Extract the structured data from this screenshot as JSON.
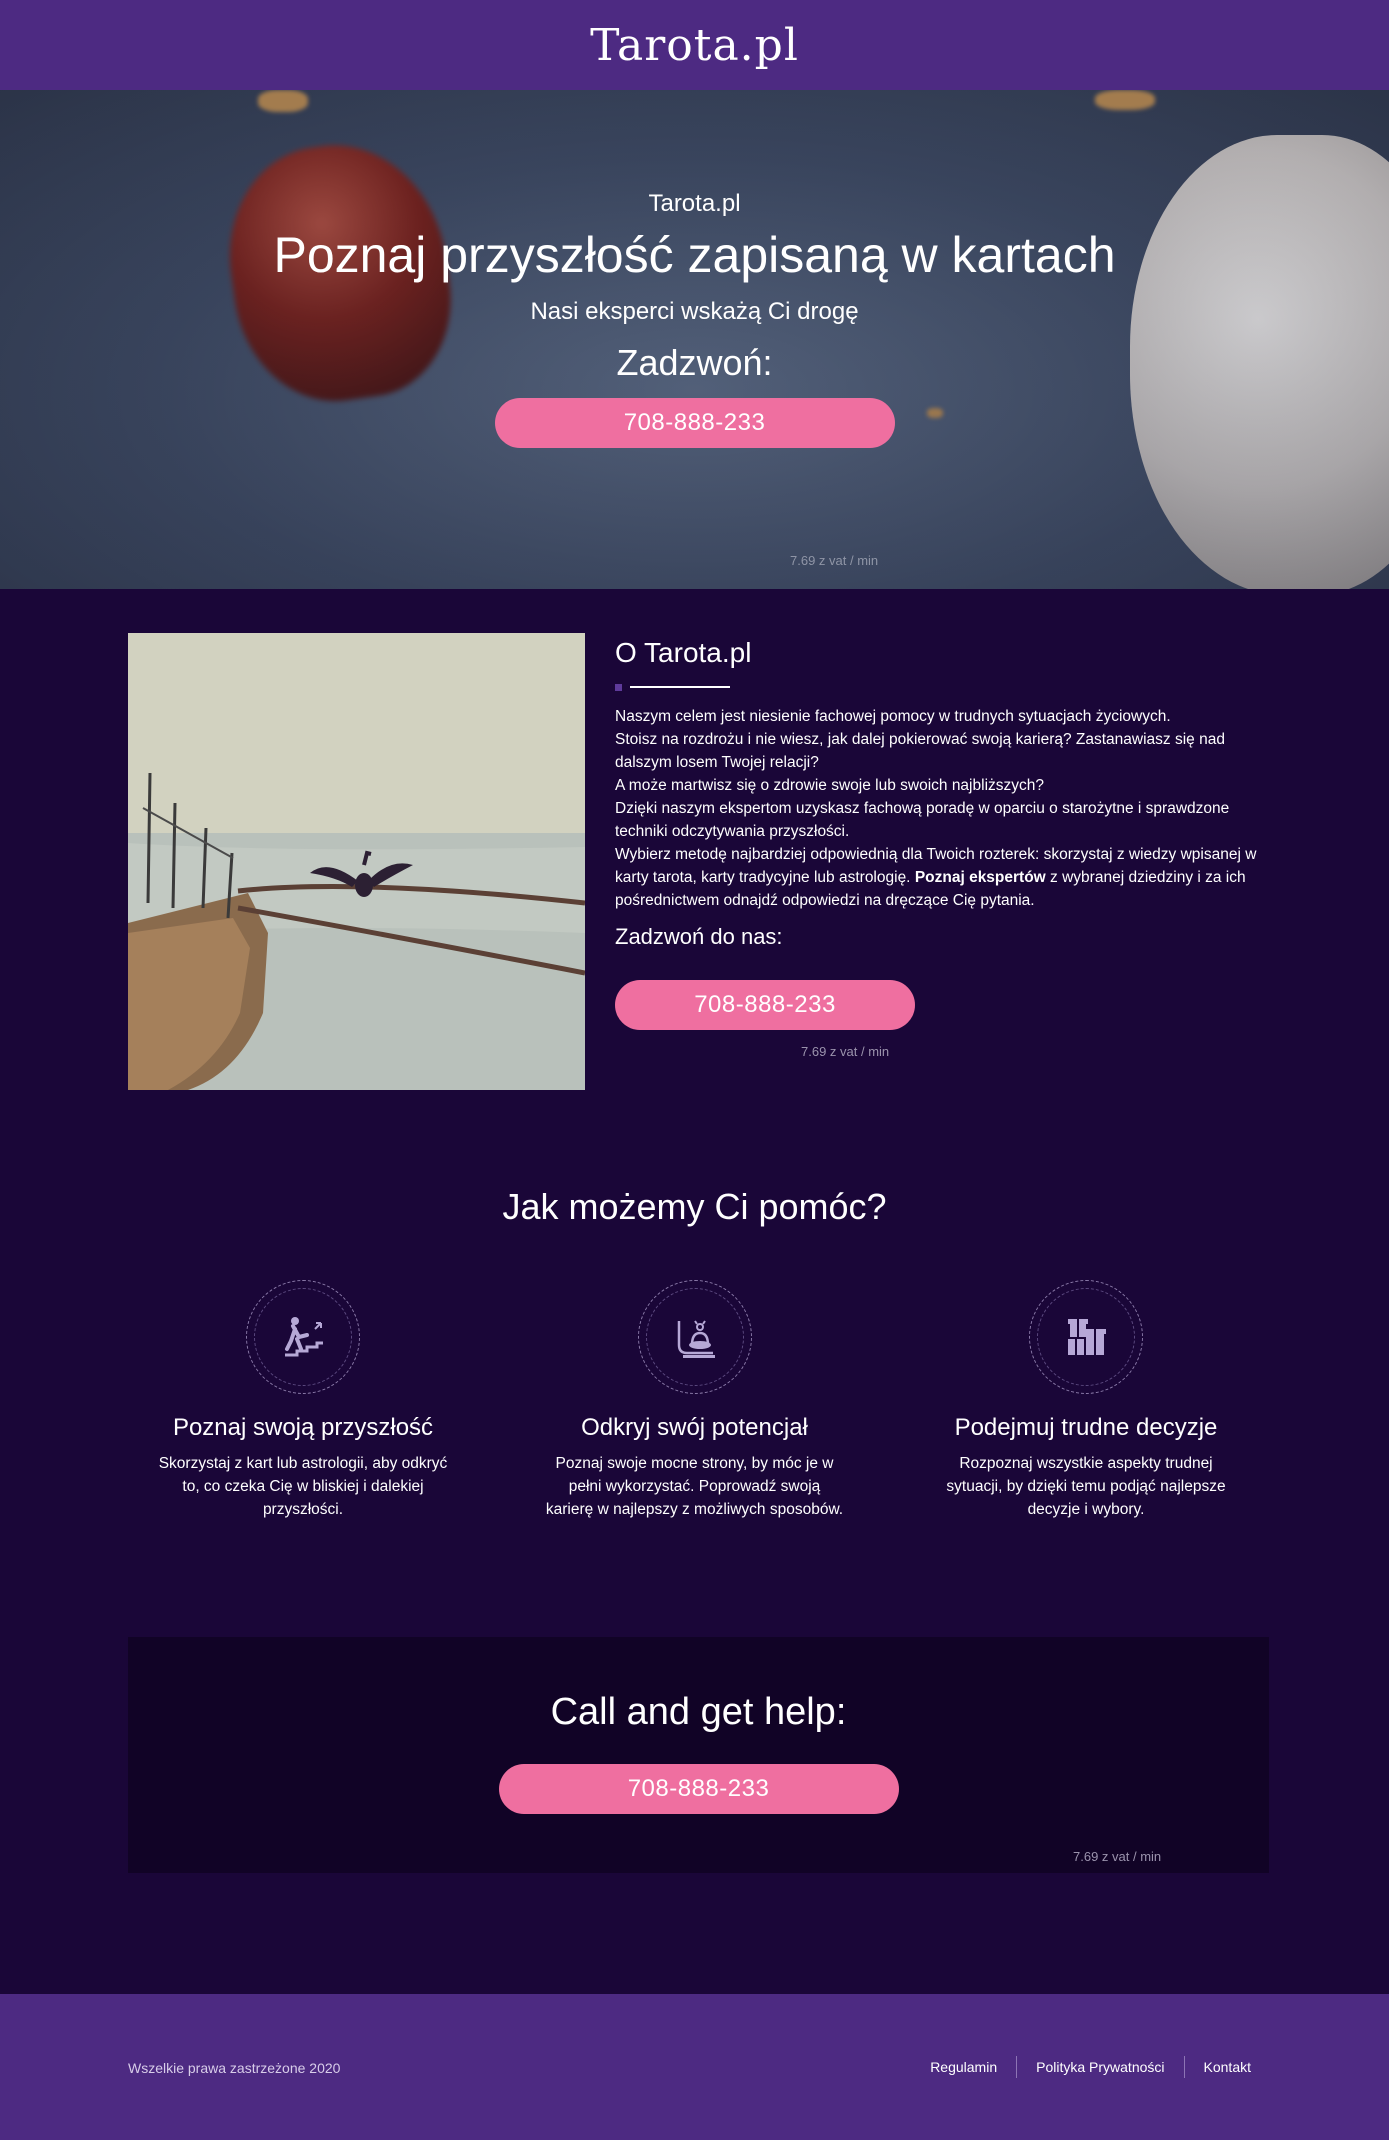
{
  "header": {
    "brand": "Tarota.pl"
  },
  "hero": {
    "kicker": "Tarota.pl",
    "title": "Poznaj przyszłość zapisaną w kartach",
    "subtitle": "Nasi eksperci wskażą Ci drogę",
    "call_label": "Zadzwoń:",
    "phone": "708-888-233",
    "rate": "7.69 z vat / min"
  },
  "about": {
    "title": "O Tarota.pl",
    "paragraphs": [
      "Naszym celem jest niesienie fachowej pomocy w trudnych sytuacjach życiowych.",
      "Stoisz na rozdrożu i nie wiesz, jak dalej pokierować swoją karierą? Zastanawiasz się nad dalszym losem Twojej relacji?",
      "A może martwisz się o zdrowie swoje lub swoich najbliższych?",
      "Dzięki naszym ekspertom uzyskasz fachową poradę w oparciu o starożytne i sprawdzone techniki odczytywania przyszłości."
    ],
    "last_paragraph_start": "Wybierz metodę najbardziej odpowiednią dla Twoich rozterek: skorzystaj z wiedzy wpisanej w karty tarota, karty tradycyjne lub astrologię. ",
    "experts_link": "Poznaj ekspertów",
    "last_paragraph_end": " z wybranej dziedziny i za ich pośrednictwem odnajdź odpowiedzi na dręczące Cię pytania.",
    "call_label": "Zadzwoń do nas:",
    "phone": "708-888-233",
    "rate": "7.69 z vat / min"
  },
  "help": {
    "title": "Jak możemy Ci pomóc?",
    "features": [
      {
        "icon": "stairs-climbing-icon",
        "title": "Poznaj swoją przyszłość",
        "text": "Skorzystaj z kart lub astrologii, aby odkryć to, co czeka Cię w bliskiej i dalekiej przyszłości."
      },
      {
        "icon": "meditation-bell-icon",
        "title": "Odkryj swój potencjał",
        "text": "Poznaj swoje mocne strony, by móc je w pełni wykorzystać. Poprowadź swoją karierę w najlepszy z możliwych sposobów."
      },
      {
        "icon": "gifts-icon",
        "title": "Podejmuj trudne decyzje",
        "text": "Rozpoznaj wszystkie aspekty trudnej sytuacji, by dzięki temu podjąć najlepsze decyzje i wybory."
      }
    ]
  },
  "cta": {
    "title": "Call and get help:",
    "phone": "708-888-233",
    "rate": "7.69 z vat / min"
  },
  "footer": {
    "copyright": "Wszelkie prawa zastrzeżone 2020",
    "links": [
      "Regulamin",
      "Polityka Prywatności",
      "Kontakt"
    ]
  },
  "colors": {
    "header_bg": "#4d2a82",
    "page_bg": "#1a0638",
    "cta_bg": "#110326",
    "button": "#ef6fa0"
  }
}
